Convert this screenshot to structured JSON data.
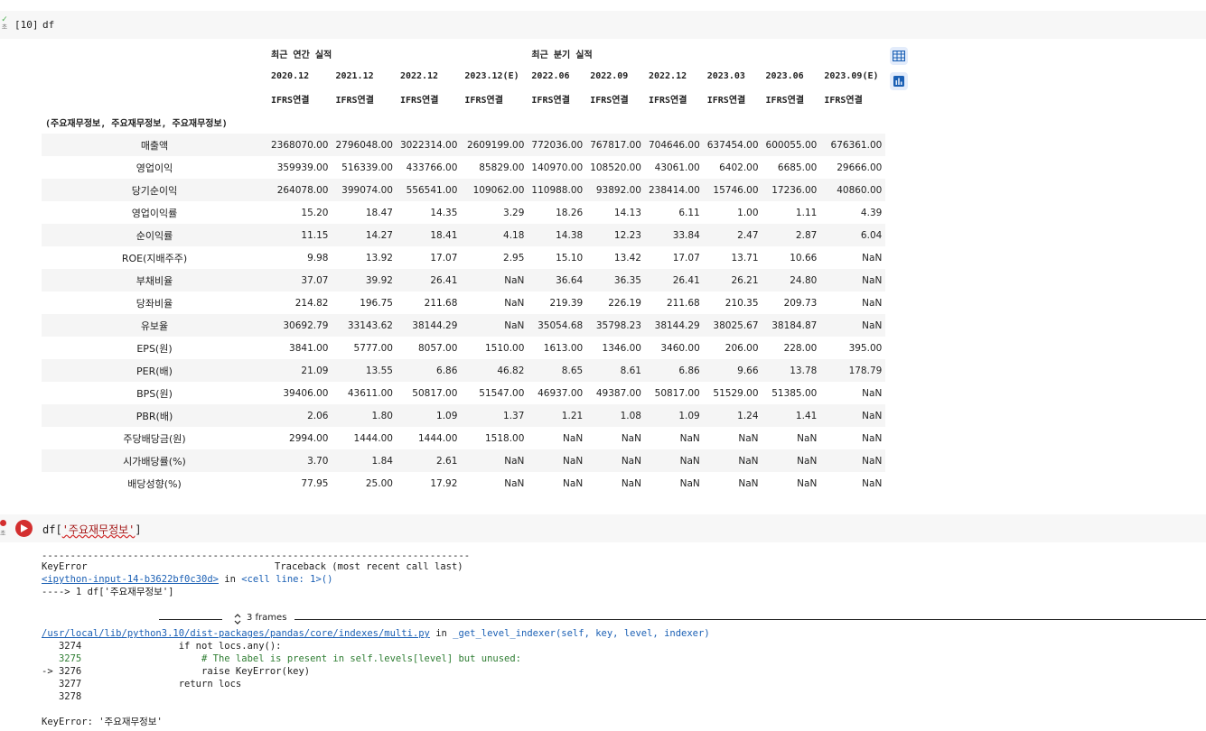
{
  "cell1": {
    "exec_mark": "✓",
    "exec_sub": "초",
    "exec_count": "[10]",
    "code": "df"
  },
  "table": {
    "group_headers": [
      "최근 연간 실적",
      "최근 분기 실적"
    ],
    "periods": [
      "2020.12",
      "2021.12",
      "2022.12",
      "2023.12(E)",
      "2022.06",
      "2022.09",
      "2022.12",
      "2023.03",
      "2023.06",
      "2023.09(E)"
    ],
    "basis": [
      "IFRS연결",
      "IFRS연결",
      "IFRS연결",
      "IFRS연결",
      "IFRS연결",
      "IFRS연결",
      "IFRS연결",
      "IFRS연결",
      "IFRS연결",
      "IFRS연결"
    ],
    "index_name": "(주요재무정보, 주요재무정보, 주요재무정보)",
    "rows": [
      {
        "label": "매출액",
        "values": [
          "2368070.00",
          "2796048.00",
          "3022314.00",
          "2609199.00",
          "772036.00",
          "767817.00",
          "704646.00",
          "637454.00",
          "600055.00",
          "676361.00"
        ]
      },
      {
        "label": "영업이익",
        "values": [
          "359939.00",
          "516339.00",
          "433766.00",
          "85829.00",
          "140970.00",
          "108520.00",
          "43061.00",
          "6402.00",
          "6685.00",
          "29666.00"
        ]
      },
      {
        "label": "당기순이익",
        "values": [
          "264078.00",
          "399074.00",
          "556541.00",
          "109062.00",
          "110988.00",
          "93892.00",
          "238414.00",
          "15746.00",
          "17236.00",
          "40860.00"
        ]
      },
      {
        "label": "영업이익률",
        "values": [
          "15.20",
          "18.47",
          "14.35",
          "3.29",
          "18.26",
          "14.13",
          "6.11",
          "1.00",
          "1.11",
          "4.39"
        ]
      },
      {
        "label": "순이익률",
        "values": [
          "11.15",
          "14.27",
          "18.41",
          "4.18",
          "14.38",
          "12.23",
          "33.84",
          "2.47",
          "2.87",
          "6.04"
        ]
      },
      {
        "label": "ROE(지배주주)",
        "values": [
          "9.98",
          "13.92",
          "17.07",
          "2.95",
          "15.10",
          "13.42",
          "17.07",
          "13.71",
          "10.66",
          "NaN"
        ]
      },
      {
        "label": "부채비율",
        "values": [
          "37.07",
          "39.92",
          "26.41",
          "NaN",
          "36.64",
          "36.35",
          "26.41",
          "26.21",
          "24.80",
          "NaN"
        ]
      },
      {
        "label": "당좌비율",
        "values": [
          "214.82",
          "196.75",
          "211.68",
          "NaN",
          "219.39",
          "226.19",
          "211.68",
          "210.35",
          "209.73",
          "NaN"
        ]
      },
      {
        "label": "유보율",
        "values": [
          "30692.79",
          "33143.62",
          "38144.29",
          "NaN",
          "35054.68",
          "35798.23",
          "38144.29",
          "38025.67",
          "38184.87",
          "NaN"
        ]
      },
      {
        "label": "EPS(원)",
        "values": [
          "3841.00",
          "5777.00",
          "8057.00",
          "1510.00",
          "1613.00",
          "1346.00",
          "3460.00",
          "206.00",
          "228.00",
          "395.00"
        ]
      },
      {
        "label": "PER(배)",
        "values": [
          "21.09",
          "13.55",
          "6.86",
          "46.82",
          "8.65",
          "8.61",
          "6.86",
          "9.66",
          "13.78",
          "178.79"
        ]
      },
      {
        "label": "BPS(원)",
        "values": [
          "39406.00",
          "43611.00",
          "50817.00",
          "51547.00",
          "46937.00",
          "49387.00",
          "50817.00",
          "51529.00",
          "51385.00",
          "NaN"
        ]
      },
      {
        "label": "PBR(배)",
        "values": [
          "2.06",
          "1.80",
          "1.09",
          "1.37",
          "1.21",
          "1.08",
          "1.09",
          "1.24",
          "1.41",
          "NaN"
        ]
      },
      {
        "label": "주당배당금(원)",
        "values": [
          "2994.00",
          "1444.00",
          "1444.00",
          "1518.00",
          "NaN",
          "NaN",
          "NaN",
          "NaN",
          "NaN",
          "NaN"
        ]
      },
      {
        "label": "시가배당률(%)",
        "values": [
          "3.70",
          "1.84",
          "2.61",
          "NaN",
          "NaN",
          "NaN",
          "NaN",
          "NaN",
          "NaN",
          "NaN"
        ]
      },
      {
        "label": "배당성향(%)",
        "values": [
          "77.95",
          "25.00",
          "17.92",
          "NaN",
          "NaN",
          "NaN",
          "NaN",
          "NaN",
          "NaN",
          "NaN"
        ]
      }
    ]
  },
  "side_buttons": {
    "table_icon": "table-icon",
    "chart_icon": "bar-chart-icon"
  },
  "cell2": {
    "err_sub": "초",
    "code_prefix": "df[",
    "code_string": "'주요재무정보'",
    "code_suffix": "]"
  },
  "traceback": {
    "dashes": "---------------------------------------------------------------------------",
    "error_name": "KeyError",
    "header_right": "Traceback (most recent call last)",
    "input_link": "<ipython-input-14-b3622bf0c30d>",
    "in_word": " in ",
    "cell_line": "<cell line: 1>()",
    "arrow_line": "----> 1 df['주요재무정보']",
    "frames_label": "3 frames",
    "file_path": "/usr/local/lib/python3.10/dist-packages/pandas/core/indexes/multi.py",
    "func_sig": "_get_level_indexer(self, key, level, indexer)",
    "code_lines": [
      "   3274                 if not locs.any():",
      "   3275                     # The label is present in self.levels[level] but unused:",
      "-> 3276                     raise KeyError(key)",
      "   3277                 return locs",
      "   3278"
    ],
    "final_error_name": "KeyError",
    "final_error_msg": ": '주요재무정보'"
  }
}
